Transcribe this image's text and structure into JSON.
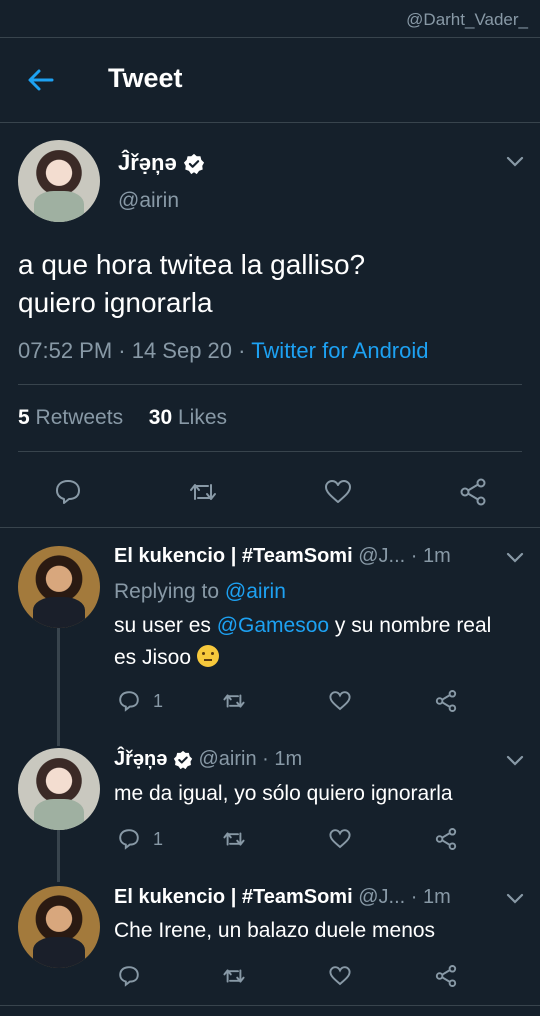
{
  "watermark": "@Darht_Vader_",
  "header": {
    "title": "Tweet"
  },
  "main_tweet": {
    "author_name": "Ĵřə̣ņə",
    "handle": "@airin",
    "text_line1": "a que hora twitea la galliso?",
    "text_line2": "quiero ignorarla",
    "time": "07:52 PM · 14 Sep 20 · ",
    "source": "Twitter for Android",
    "retweets_count": "5",
    "retweets_label": "Retweets",
    "likes_count": "30",
    "likes_label": "Likes"
  },
  "replies": [
    {
      "author_name": "El kukencio | #TeamSomi",
      "handle": "@J...",
      "time": "· 1m",
      "replying_prefix": "Replying to ",
      "replying_to": "@airin",
      "text_pre": "su user es ",
      "mention": "@Gamesoo",
      "text_post": " y su nombre real",
      "text_line2": "es Jisoo",
      "reply_count": "1"
    },
    {
      "author_name": "Ĵřə̣ņə",
      "handle": "@airin",
      "time": "· 1m",
      "text": "me da igual, yo sólo quiero ignorarla",
      "reply_count": "1"
    },
    {
      "author_name": "El kukencio | #TeamSomi",
      "handle": "@J...",
      "time": "· 1m",
      "text": "Che Irene, un balazo duele menos"
    }
  ],
  "colors": {
    "background": "#15202b",
    "accent": "#1da1f2",
    "muted": "#8899a6",
    "divider": "#38444d"
  }
}
